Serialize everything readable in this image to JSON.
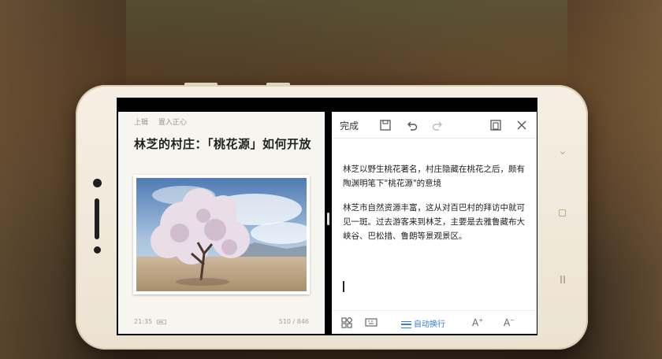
{
  "left_pane": {
    "breadcrumb": [
      "上辑",
      "置入正心"
    ],
    "title": "林芝的村庄：「桃花源」如何开放",
    "time": "21:35",
    "page_counter": "510 / 846"
  },
  "right_pane": {
    "toolbar": {
      "done_label": "完成",
      "icons": [
        "save-icon",
        "undo-icon",
        "redo-icon",
        "copy-window-icon",
        "close-icon"
      ]
    },
    "paragraphs": [
      "林芝以野生桃花著名，村庄隐藏在桃花之后，颇有陶渊明笔下\"桃花源\"的意境",
      "林芝市自然资源丰富，这从对百巴村的拜访中就可见一斑。过去游客来到林芝，主要是去雅鲁藏布大峡谷、巴松措、鲁朗等景观景区。"
    ],
    "bottombar": {
      "auto_wrap_label": "自动换行",
      "icons": [
        "grid-icon",
        "keyboard-icon",
        "font-increase-icon",
        "font-decrease-icon"
      ]
    }
  },
  "device": {
    "nav_icons": [
      "chevron-down-icon",
      "home-icon",
      "menu-icon"
    ]
  },
  "colors": {
    "accent": "#3b7ae0",
    "phone_body": "#f3ebdc"
  }
}
